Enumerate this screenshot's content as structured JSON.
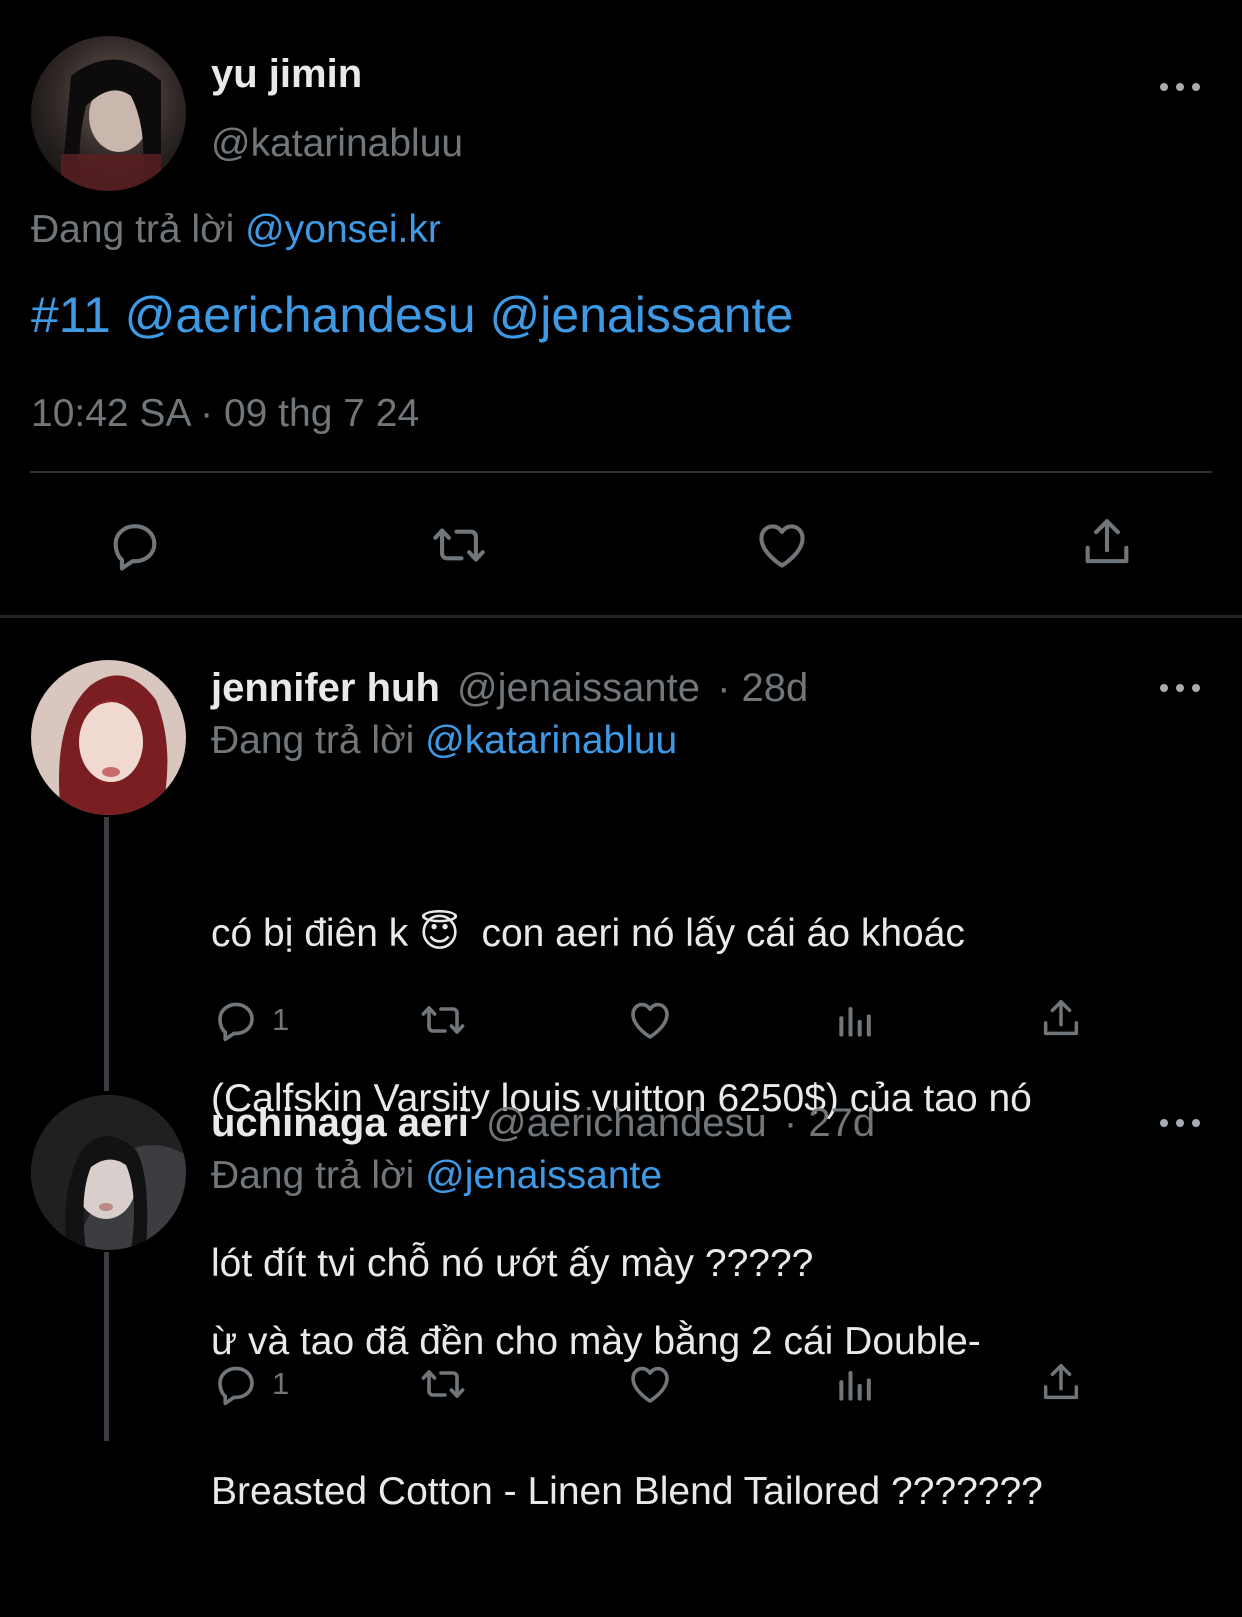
{
  "main_tweet": {
    "display_name": "yu jimin",
    "handle": "@katarinabluu",
    "replying_prefix": "Đang trả lời",
    "replying_to": "@yonsei.kr",
    "hashtag": "#11",
    "mention_1": "@aerichandesu",
    "mention_2": "@jenaissante",
    "timestamp": "10:42 SA · 09 thg 7 24"
  },
  "replies": [
    {
      "display_name": "jennifer huh",
      "handle": "@jenaissante",
      "time": "· 28d",
      "replying_prefix": "Đang trả lời",
      "replying_to": "@katarinabluu",
      "text_line_1": "có bị điên k 😇  con aeri nó lấy cái áo khoác",
      "text_line_2": "(Calfskin Varsity louis vuitton 6250$) của tao nó",
      "text_line_3": "lót đít tvi chỗ nó ướt ấy mày ?????",
      "reply_count": "1"
    },
    {
      "display_name": "uchinaga aeri",
      "handle": "@aerichandesu",
      "time": "· 27d",
      "replying_prefix": "Đang trả lời",
      "replying_to": "@jenaissante",
      "text_line_1": "ừ và tao đã đền cho mày bằng 2 cái Double-",
      "text_line_2": "Breasted Cotton - Linen Blend Tailored ???????",
      "reply_count": "1"
    }
  ],
  "icons": {
    "reply": "reply-icon",
    "retweet": "retweet-icon",
    "like": "like-icon",
    "views": "views-icon",
    "share": "share-icon",
    "more": "more-icon"
  },
  "colors": {
    "background": "#000000",
    "link": "#3f9ae6",
    "muted": "#71767b",
    "text": "#e7e9ea"
  }
}
